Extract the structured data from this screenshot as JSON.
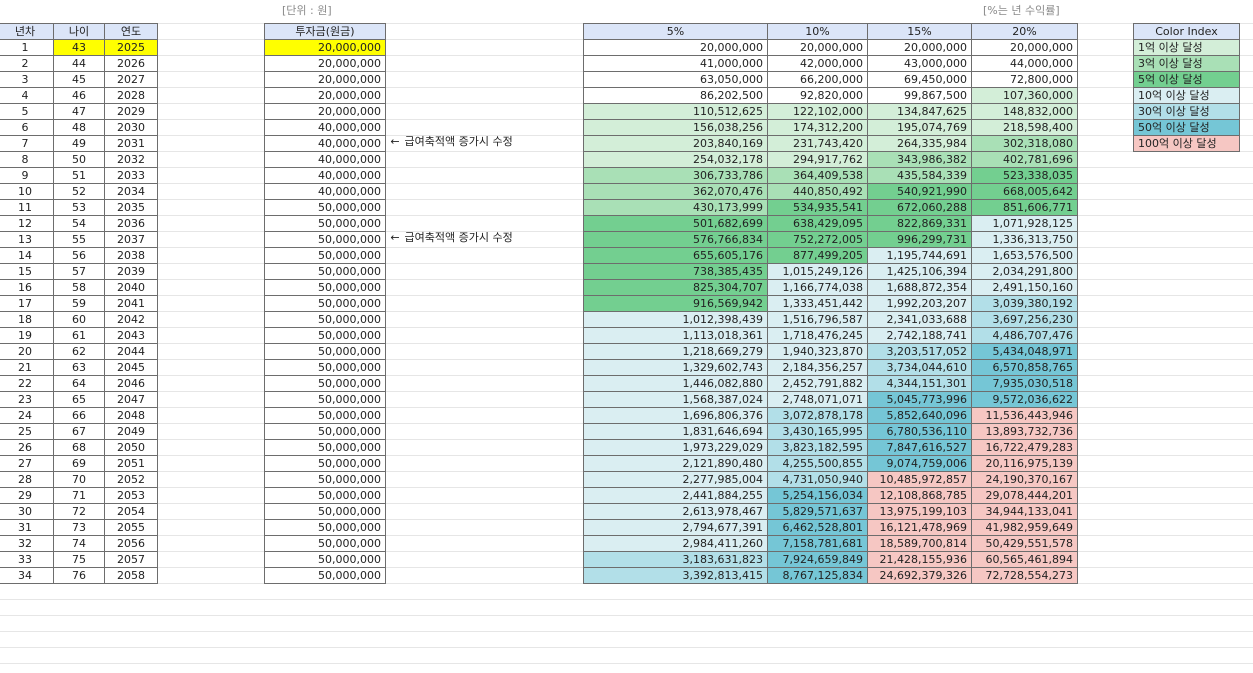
{
  "units": {
    "won_label": "[단위 : 원]",
    "rate_label": "[%는 년 수익률]"
  },
  "headers": {
    "year_no": "년차",
    "age": "나이",
    "year": "연도",
    "invest": "투자금(원금)",
    "rates": [
      "5%",
      "10%",
      "15%",
      "20%"
    ]
  },
  "notes": {
    "arrow": "←",
    "salary_change": "급여축적액 증가시 수정"
  },
  "legend": {
    "title": "Color Index",
    "items": [
      {
        "label": "1억 이상 달성",
        "color": "#d3eed8"
      },
      {
        "label": "3억 이상 달성",
        "color": "#a9e0b6"
      },
      {
        "label": "5억 이상 달성",
        "color": "#73cf90"
      },
      {
        "label": "10억 이상 달성",
        "color": "#daeef2"
      },
      {
        "label": "30억 이상 달성",
        "color": "#b2dfe8"
      },
      {
        "label": "50억 이상 달성",
        "color": "#75c6d6"
      },
      {
        "label": "100억 이상 달성",
        "color": "#f6c7c3"
      }
    ]
  },
  "rows": [
    {
      "n": "1",
      "age": "43",
      "year": "2025",
      "invest": "20,000,000",
      "r5": "20,000,000",
      "r10": "20,000,000",
      "r15": "20,000,000",
      "r20": "20,000,000"
    },
    {
      "n": "2",
      "age": "44",
      "year": "2026",
      "invest": "20,000,000",
      "r5": "41,000,000",
      "r10": "42,000,000",
      "r15": "43,000,000",
      "r20": "44,000,000"
    },
    {
      "n": "3",
      "age": "45",
      "year": "2027",
      "invest": "20,000,000",
      "r5": "63,050,000",
      "r10": "66,200,000",
      "r15": "69,450,000",
      "r20": "72,800,000"
    },
    {
      "n": "4",
      "age": "46",
      "year": "2028",
      "invest": "20,000,000",
      "r5": "86,202,500",
      "r10": "92,820,000",
      "r15": "99,867,500",
      "r20": "107,360,000"
    },
    {
      "n": "5",
      "age": "47",
      "year": "2029",
      "invest": "20,000,000",
      "r5": "110,512,625",
      "r10": "122,102,000",
      "r15": "134,847,625",
      "r20": "148,832,000"
    },
    {
      "n": "6",
      "age": "48",
      "year": "2030",
      "invest": "40,000,000",
      "r5": "156,038,256",
      "r10": "174,312,200",
      "r15": "195,074,769",
      "r20": "218,598,400"
    },
    {
      "n": "7",
      "age": "49",
      "year": "2031",
      "invest": "40,000,000",
      "r5": "203,840,169",
      "r10": "231,743,420",
      "r15": "264,335,984",
      "r20": "302,318,080"
    },
    {
      "n": "8",
      "age": "50",
      "year": "2032",
      "invest": "40,000,000",
      "r5": "254,032,178",
      "r10": "294,917,762",
      "r15": "343,986,382",
      "r20": "402,781,696"
    },
    {
      "n": "9",
      "age": "51",
      "year": "2033",
      "invest": "40,000,000",
      "r5": "306,733,786",
      "r10": "364,409,538",
      "r15": "435,584,339",
      "r20": "523,338,035"
    },
    {
      "n": "10",
      "age": "52",
      "year": "2034",
      "invest": "40,000,000",
      "r5": "362,070,476",
      "r10": "440,850,492",
      "r15": "540,921,990",
      "r20": "668,005,642"
    },
    {
      "n": "11",
      "age": "53",
      "year": "2035",
      "invest": "50,000,000",
      "r5": "430,173,999",
      "r10": "534,935,541",
      "r15": "672,060,288",
      "r20": "851,606,771"
    },
    {
      "n": "12",
      "age": "54",
      "year": "2036",
      "invest": "50,000,000",
      "r5": "501,682,699",
      "r10": "638,429,095",
      "r15": "822,869,331",
      "r20": "1,071,928,125"
    },
    {
      "n": "13",
      "age": "55",
      "year": "2037",
      "invest": "50,000,000",
      "r5": "576,766,834",
      "r10": "752,272,005",
      "r15": "996,299,731",
      "r20": "1,336,313,750"
    },
    {
      "n": "14",
      "age": "56",
      "year": "2038",
      "invest": "50,000,000",
      "r5": "655,605,176",
      "r10": "877,499,205",
      "r15": "1,195,744,691",
      "r20": "1,653,576,500"
    },
    {
      "n": "15",
      "age": "57",
      "year": "2039",
      "invest": "50,000,000",
      "r5": "738,385,435",
      "r10": "1,015,249,126",
      "r15": "1,425,106,394",
      "r20": "2,034,291,800"
    },
    {
      "n": "16",
      "age": "58",
      "year": "2040",
      "invest": "50,000,000",
      "r5": "825,304,707",
      "r10": "1,166,774,038",
      "r15": "1,688,872,354",
      "r20": "2,491,150,160"
    },
    {
      "n": "17",
      "age": "59",
      "year": "2041",
      "invest": "50,000,000",
      "r5": "916,569,942",
      "r10": "1,333,451,442",
      "r15": "1,992,203,207",
      "r20": "3,039,380,192"
    },
    {
      "n": "18",
      "age": "60",
      "year": "2042",
      "invest": "50,000,000",
      "r5": "1,012,398,439",
      "r10": "1,516,796,587",
      "r15": "2,341,033,688",
      "r20": "3,697,256,230"
    },
    {
      "n": "19",
      "age": "61",
      "year": "2043",
      "invest": "50,000,000",
      "r5": "1,113,018,361",
      "r10": "1,718,476,245",
      "r15": "2,742,188,741",
      "r20": "4,486,707,476"
    },
    {
      "n": "20",
      "age": "62",
      "year": "2044",
      "invest": "50,000,000",
      "r5": "1,218,669,279",
      "r10": "1,940,323,870",
      "r15": "3,203,517,052",
      "r20": "5,434,048,971"
    },
    {
      "n": "21",
      "age": "63",
      "year": "2045",
      "invest": "50,000,000",
      "r5": "1,329,602,743",
      "r10": "2,184,356,257",
      "r15": "3,734,044,610",
      "r20": "6,570,858,765"
    },
    {
      "n": "22",
      "age": "64",
      "year": "2046",
      "invest": "50,000,000",
      "r5": "1,446,082,880",
      "r10": "2,452,791,882",
      "r15": "4,344,151,301",
      "r20": "7,935,030,518"
    },
    {
      "n": "23",
      "age": "65",
      "year": "2047",
      "invest": "50,000,000",
      "r5": "1,568,387,024",
      "r10": "2,748,071,071",
      "r15": "5,045,773,996",
      "r20": "9,572,036,622"
    },
    {
      "n": "24",
      "age": "66",
      "year": "2048",
      "invest": "50,000,000",
      "r5": "1,696,806,376",
      "r10": "3,072,878,178",
      "r15": "5,852,640,096",
      "r20": "11,536,443,946"
    },
    {
      "n": "25",
      "age": "67",
      "year": "2049",
      "invest": "50,000,000",
      "r5": "1,831,646,694",
      "r10": "3,430,165,995",
      "r15": "6,780,536,110",
      "r20": "13,893,732,736"
    },
    {
      "n": "26",
      "age": "68",
      "year": "2050",
      "invest": "50,000,000",
      "r5": "1,973,229,029",
      "r10": "3,823,182,595",
      "r15": "7,847,616,527",
      "r20": "16,722,479,283"
    },
    {
      "n": "27",
      "age": "69",
      "year": "2051",
      "invest": "50,000,000",
      "r5": "2,121,890,480",
      "r10": "4,255,500,855",
      "r15": "9,074,759,006",
      "r20": "20,116,975,139"
    },
    {
      "n": "28",
      "age": "70",
      "year": "2052",
      "invest": "50,000,000",
      "r5": "2,277,985,004",
      "r10": "4,731,050,940",
      "r15": "10,485,972,857",
      "r20": "24,190,370,167"
    },
    {
      "n": "29",
      "age": "71",
      "year": "2053",
      "invest": "50,000,000",
      "r5": "2,441,884,255",
      "r10": "5,254,156,034",
      "r15": "12,108,868,785",
      "r20": "29,078,444,201"
    },
    {
      "n": "30",
      "age": "72",
      "year": "2054",
      "invest": "50,000,000",
      "r5": "2,613,978,467",
      "r10": "5,829,571,637",
      "r15": "13,975,199,103",
      "r20": "34,944,133,041"
    },
    {
      "n": "31",
      "age": "73",
      "year": "2055",
      "invest": "50,000,000",
      "r5": "2,794,677,391",
      "r10": "6,462,528,801",
      "r15": "16,121,478,969",
      "r20": "41,982,959,649"
    },
    {
      "n": "32",
      "age": "74",
      "year": "2056",
      "invest": "50,000,000",
      "r5": "2,984,411,260",
      "r10": "7,158,781,681",
      "r15": "18,589,700,814",
      "r20": "50,429,551,578"
    },
    {
      "n": "33",
      "age": "75",
      "year": "2057",
      "invest": "50,000,000",
      "r5": "3,183,631,823",
      "r10": "7,924,659,849",
      "r15": "21,428,155,936",
      "r20": "60,565,461,894"
    },
    {
      "n": "34",
      "age": "76",
      "year": "2058",
      "invest": "50,000,000",
      "r5": "3,392,813,415",
      "r10": "8,767,125,834",
      "r15": "24,692,379,326",
      "r20": "72,728,554,273"
    }
  ]
}
